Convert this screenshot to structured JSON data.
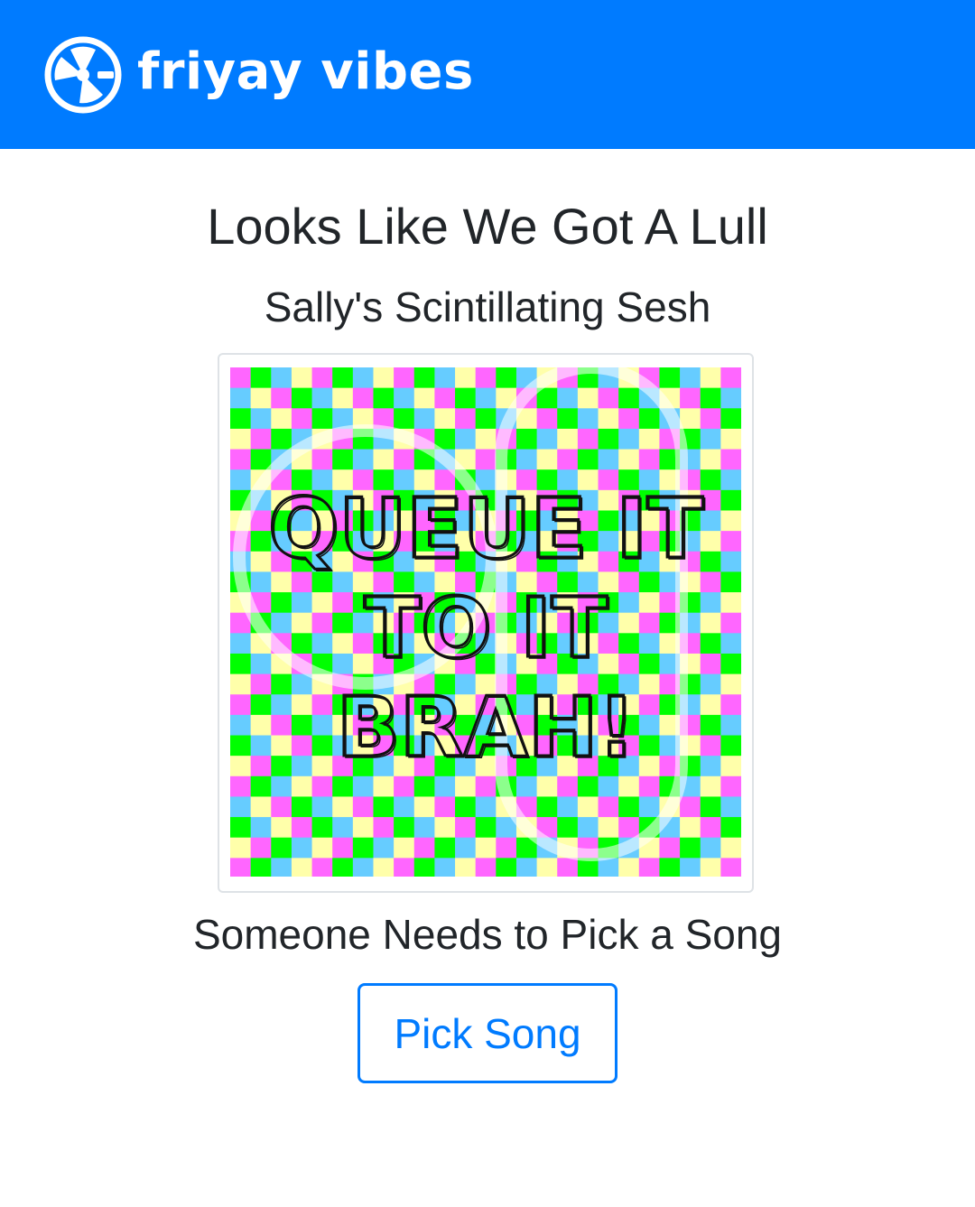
{
  "navbar": {
    "brand_name": "friyay vibes",
    "brand_icon": "record-reel-icon",
    "color": "#007bff"
  },
  "main": {
    "heading": "Looks Like We Got A Lull",
    "session_name": "Sally's Scintillating Sesh",
    "artwork": {
      "lines": [
        "QUEUE IT",
        "TO IT",
        "BRAH!"
      ],
      "palette": [
        "#ff66ff",
        "#00ff00",
        "#66ccff",
        "#ffffaa"
      ]
    },
    "status": "Someone Needs to Pick a Song",
    "pick_button_label": "Pick Song"
  }
}
